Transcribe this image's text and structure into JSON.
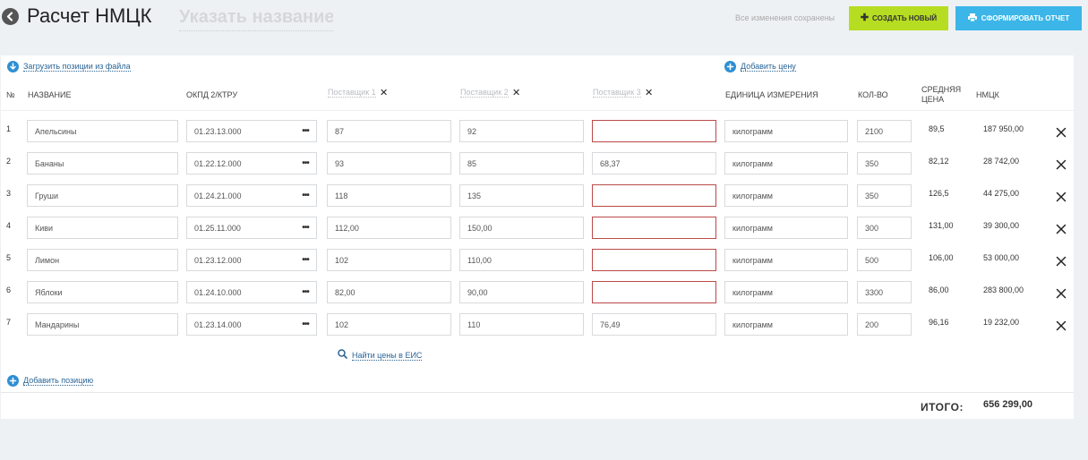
{
  "header": {
    "title": "Расчет НМЦК",
    "name_placeholder": "Указать название",
    "save_status": "Все изменения сохранены",
    "create_label": "СОЗДАТЬ НОВЫЙ",
    "report_label": "СФОРМИРОВАТЬ ОТЧЕТ"
  },
  "links": {
    "upload_file": "Загрузить позиции из файла",
    "add_price": "Добавить цену",
    "find_prices": "Найти цены в ЕИС",
    "add_position": "Добавить позицию"
  },
  "columns": {
    "num": "№",
    "name": "НАЗВАНИЕ",
    "okpd": "ОКПД 2/КТРУ",
    "supplier1": "Поставщик 1",
    "supplier2": "Поставщик 2",
    "supplier3": "Поставщик 3",
    "unit": "ЕДИНИЦА ИЗМЕРЕНИЯ",
    "qty": "КОЛ-ВО",
    "avg_line1": "СРЕДНЯЯ",
    "avg_line2": "ЦЕНА",
    "nmck": "НМЦК"
  },
  "rows": [
    {
      "num": "1",
      "name": "Апельсины",
      "okpd": "01.23.13.000",
      "s1": "87",
      "s2": "92",
      "s3": "",
      "unit": "килограмм",
      "qty": "2100",
      "avg": "89,5",
      "nmck": "187 950,00"
    },
    {
      "num": "2",
      "name": "Бананы",
      "okpd": "01.22.12.000",
      "s1": "93",
      "s2": "85",
      "s3": "68,37",
      "unit": "килограмм",
      "qty": "350",
      "avg": "82,12",
      "nmck": "28 742,00"
    },
    {
      "num": "3",
      "name": "Груши",
      "okpd": "01.24.21.000",
      "s1": "118",
      "s2": "135",
      "s3": "",
      "unit": "килограмм",
      "qty": "350",
      "avg": "126,5",
      "nmck": "44 275,00"
    },
    {
      "num": "4",
      "name": "Киви",
      "okpd": "01.25.11.000",
      "s1": "112,00",
      "s2": "150,00",
      "s3": "",
      "unit": "килограмм",
      "qty": "300",
      "avg": "131,00",
      "nmck": "39 300,00"
    },
    {
      "num": "5",
      "name": "Лимон",
      "okpd": "01.23.12.000",
      "s1": "102",
      "s2": "110,00",
      "s3": "",
      "unit": "килограмм",
      "qty": "500",
      "avg": "106,00",
      "nmck": "53 000,00"
    },
    {
      "num": "6",
      "name": "Яблоки",
      "okpd": "01.24.10.000",
      "s1": "82,00",
      "s2": "90,00",
      "s3": "",
      "unit": "килограмм",
      "qty": "3300",
      "avg": "86,00",
      "nmck": "283 800,00"
    },
    {
      "num": "7",
      "name": "Мандарины",
      "okpd": "01.23.14.000",
      "s1": "102",
      "s2": "110",
      "s3": "76,49",
      "unit": "килограмм",
      "qty": "200",
      "avg": "96,16",
      "nmck": "19 232,00"
    }
  ],
  "totals": {
    "label": "ИТОГО:",
    "value": "656 299,00"
  },
  "colors": {
    "accent_green": "#b7dd22",
    "accent_blue": "#3cb6e8",
    "error_border": "#b94a48",
    "link": "#2a6496"
  }
}
